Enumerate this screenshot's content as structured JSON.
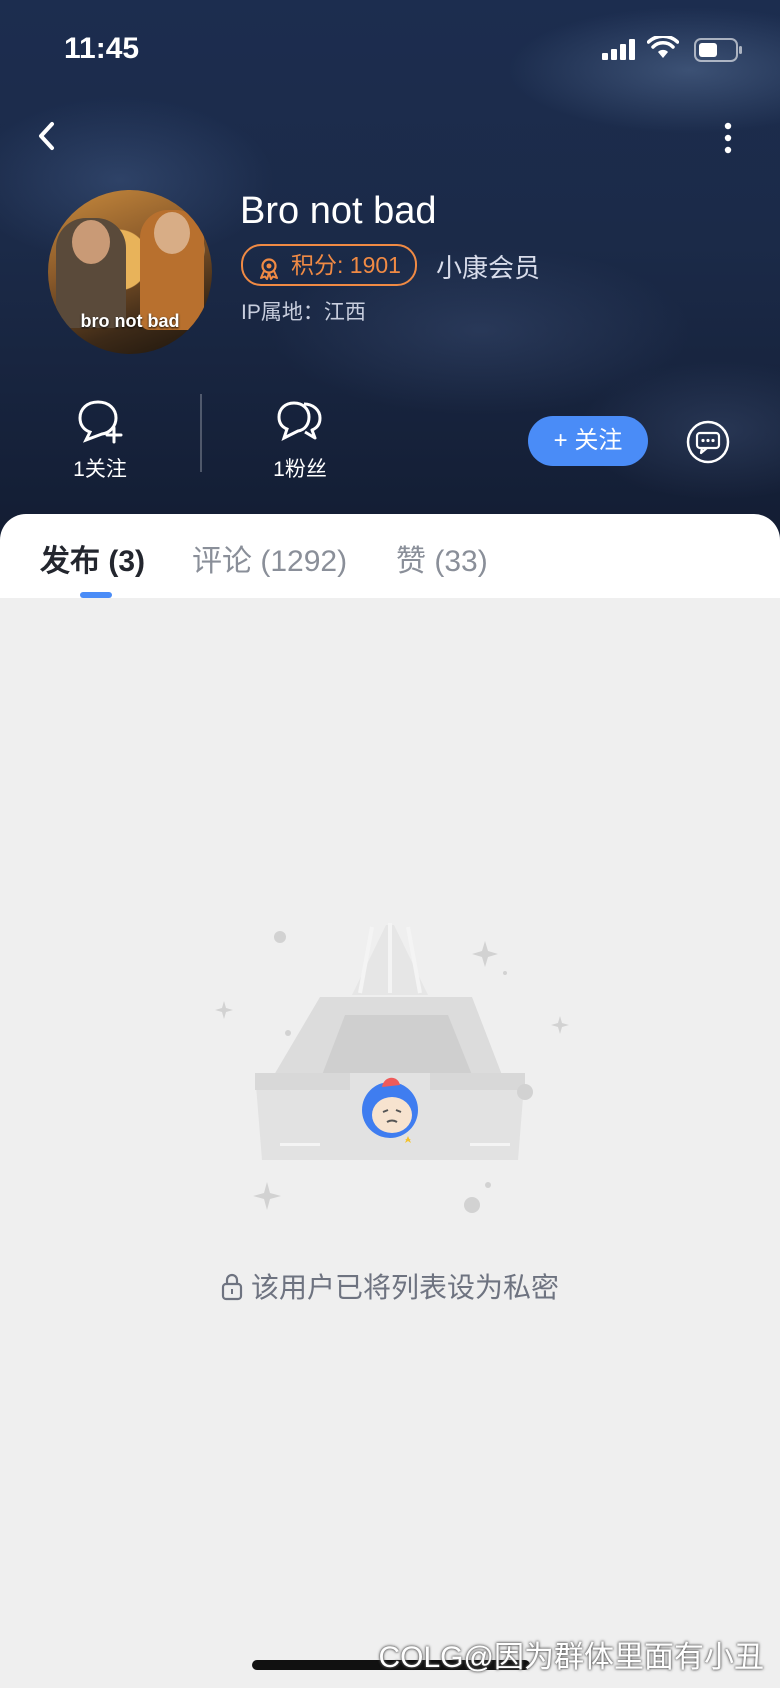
{
  "status_bar": {
    "time": "11:45"
  },
  "profile": {
    "username": "Bro not bad",
    "avatar_caption": "bro not bad",
    "points_label": "积分: 1901",
    "member_label": "小康会员",
    "ip_location": "IP属地：江西",
    "following_label": "1关注",
    "followers_label": "1粉丝",
    "follow_button": "+ 关注"
  },
  "tabs": [
    {
      "label": "发布 (3)",
      "active": true
    },
    {
      "label": "评论 (1292)",
      "active": false
    },
    {
      "label": "赞 (33)",
      "active": false
    }
  ],
  "empty_state": {
    "message": "该用户已将列表设为私密"
  },
  "watermark": "@因为群体里面有小丑",
  "watermark_logo": "COLG",
  "colors": {
    "accent": "#4a8cf7",
    "points": "#f08a44",
    "header_bg": "#1b2a48"
  },
  "icons": [
    "signal-icon",
    "wifi-icon",
    "battery-icon",
    "back-icon",
    "more-icon",
    "medal-icon",
    "follow-user-icon",
    "fans-icon",
    "message-icon",
    "lock-icon"
  ]
}
